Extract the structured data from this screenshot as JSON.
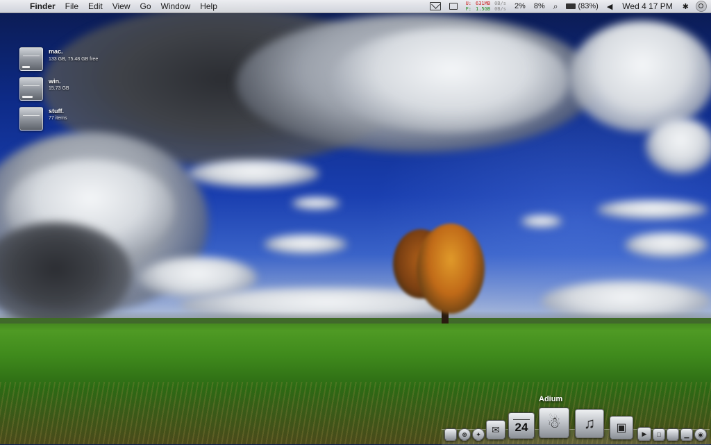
{
  "menubar": {
    "apple_icon": "apple-icon",
    "app_name": "Finder",
    "menus": [
      "File",
      "Edit",
      "View",
      "Go",
      "Window",
      "Help"
    ],
    "stats": {
      "u_label": "U:",
      "u_value": "631MB",
      "u_rate": "0B/s",
      "f_label": "F:",
      "f_value": "1.5GB",
      "f_rate": "0B/s"
    },
    "cpu1": "2%",
    "cpu2": "8%",
    "battery": "(83%)",
    "clock": "Wed 4 17 PM"
  },
  "drives": [
    {
      "name": "mac.",
      "sub": "133 GB, 75.48 GB free",
      "fill": 0.43,
      "has_apple": true
    },
    {
      "name": "win.",
      "sub": "15.73 GB",
      "fill": 0.6,
      "has_apple": false
    },
    {
      "name": "stuff.",
      "sub": "77 items",
      "fill": 0.0,
      "has_apple": false
    }
  ],
  "dock": {
    "hover_label": "Adium",
    "calendar_day": "24",
    "items": [
      "preview-icon",
      "safari-icon",
      "compass-icon",
      "mail-icon",
      "ical-icon",
      "adium-icon",
      "itunes-icon",
      "camera-icon",
      "flash-icon",
      "window-icon",
      "apple-icon",
      "stats-icon",
      "eye-icon"
    ]
  },
  "colors": {
    "sky": "#0d2a86",
    "grass": "#3f8a1c",
    "tree": "#c87a1a"
  }
}
